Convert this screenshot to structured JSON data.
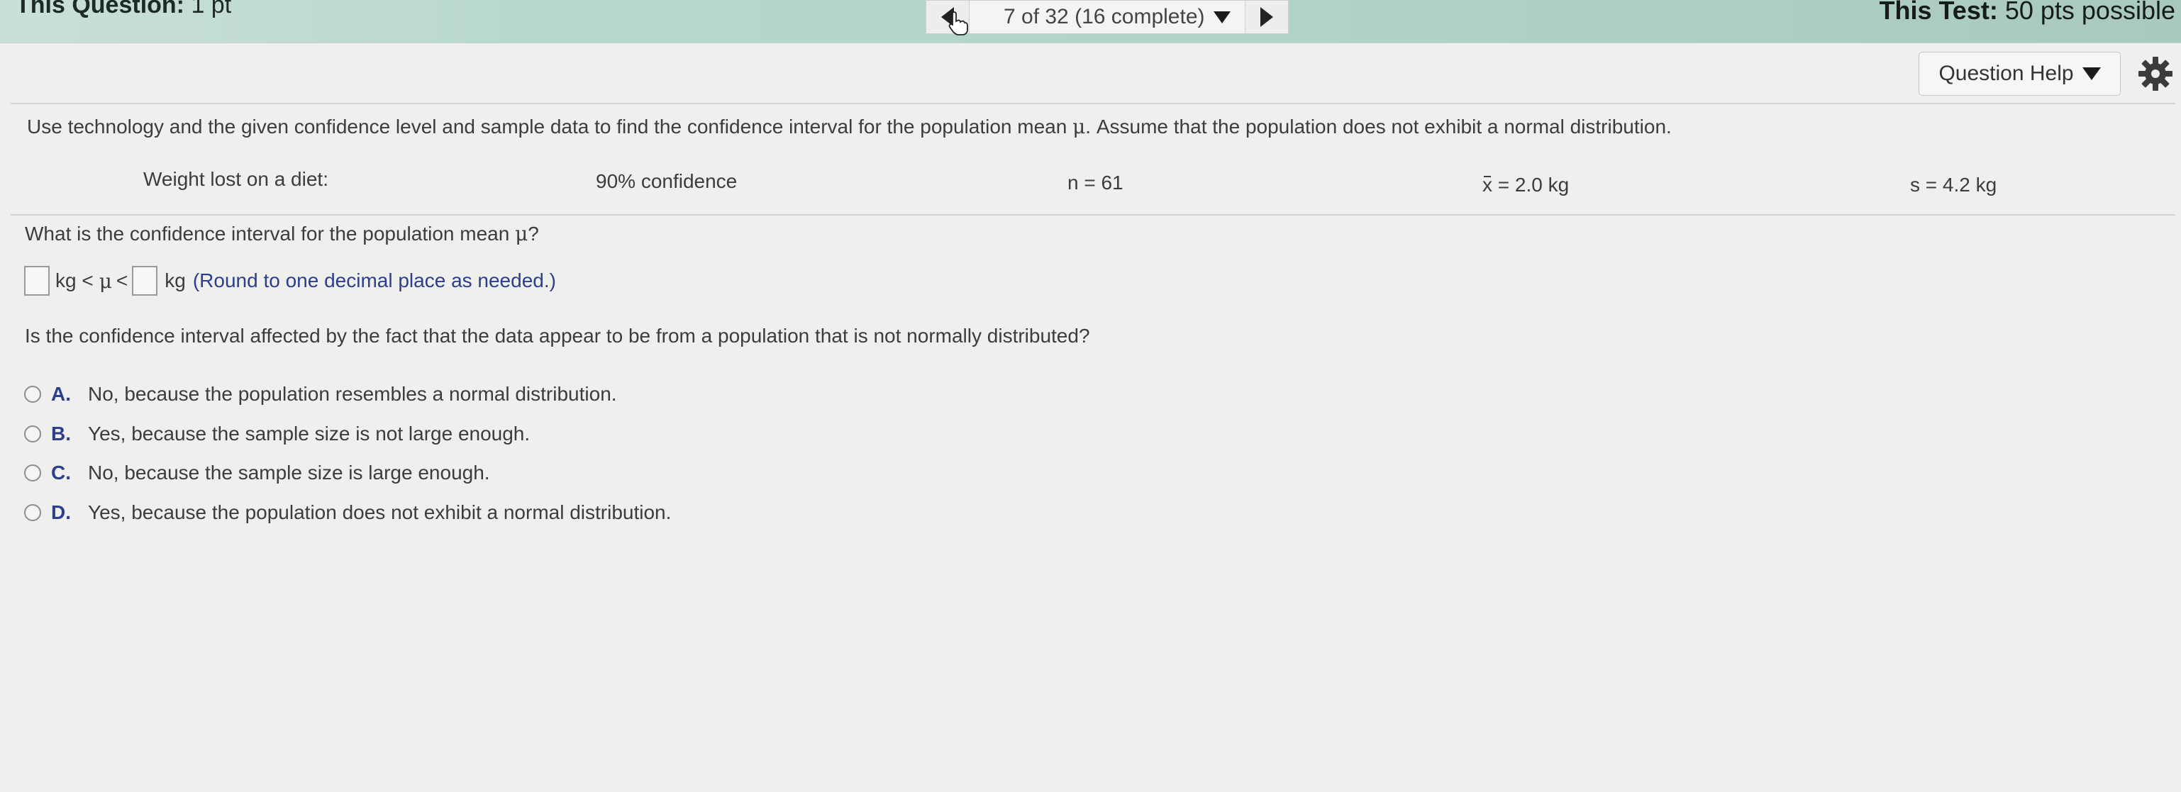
{
  "header": {
    "question_label": "This Question:",
    "question_points": "1 pt",
    "nav_progress": "7 of 32 (16 complete)",
    "test_label": "This Test:",
    "test_points": "50 pts possible"
  },
  "toolbar": {
    "help_label": "Question Help"
  },
  "question": {
    "prompt_a": "Use technology and the given confidence level and sample data to find the confidence interval for the population mean ",
    "mu": "μ",
    "prompt_b": ". Assume that the population does not exhibit a normal distribution.",
    "data_label": "Weight lost on a diet:",
    "confidence": "90% confidence",
    "n": "n = 61",
    "xbar_symbol": "x",
    "xbar_value": " = 2.0 kg",
    "s": "s = 4.2 kg",
    "part1_a": "What is the confidence interval for the population mean ",
    "part1_b": "?",
    "answer": {
      "unit_left": "kg <",
      "mu": "μ",
      "lt": "<",
      "unit_right": "kg",
      "instruction": "(Round to one decimal place as needed.)"
    },
    "part2": "Is the confidence interval affected by the fact that the data appear to be from a population that is not normally distributed?",
    "options": [
      {
        "letter": "A.",
        "text": "No, because the population resembles a normal distribution."
      },
      {
        "letter": "B.",
        "text": "Yes, because the sample size is not large enough."
      },
      {
        "letter": "C.",
        "text": "No, because the sample size is large enough."
      },
      {
        "letter": "D.",
        "text": "Yes, because the population does not exhibit a normal distribution."
      }
    ]
  },
  "icons": {
    "prev": "triangle-left-icon",
    "next": "triangle-right-icon",
    "dropdown": "chevron-down-icon",
    "settings": "gear-icon",
    "cursor": "hand-cursor-icon"
  }
}
